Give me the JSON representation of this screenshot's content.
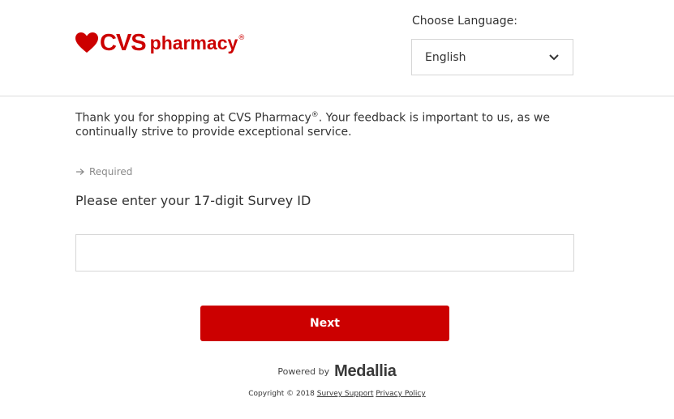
{
  "brand": {
    "logo_text_cvs": "CVS",
    "logo_text_pharmacy": "pharmacy",
    "logo_reg": "®",
    "color": "#cc0000"
  },
  "language": {
    "label": "Choose Language:",
    "selected": "English"
  },
  "intro": {
    "line_a": "Thank you for shopping at CVS Pharmacy",
    "reg": "®",
    "line_b": ". Your feedback is important to us, as we continually strive to provide exceptional service."
  },
  "required_label": "Required",
  "question": "Please enter your 17-digit Survey ID",
  "survey_input": {
    "value": "",
    "placeholder": ""
  },
  "next_label": "Next",
  "footer": {
    "powered_by": "Powered by",
    "medallia": "Medallia",
    "copyright": "Copyright © 2018",
    "survey_support": "Survey Support",
    "privacy_policy": "Privacy Policy"
  },
  "icons": {
    "heart": "heart-icon",
    "chevron": "chevron-down-icon",
    "arrow": "arrow-right-icon"
  }
}
